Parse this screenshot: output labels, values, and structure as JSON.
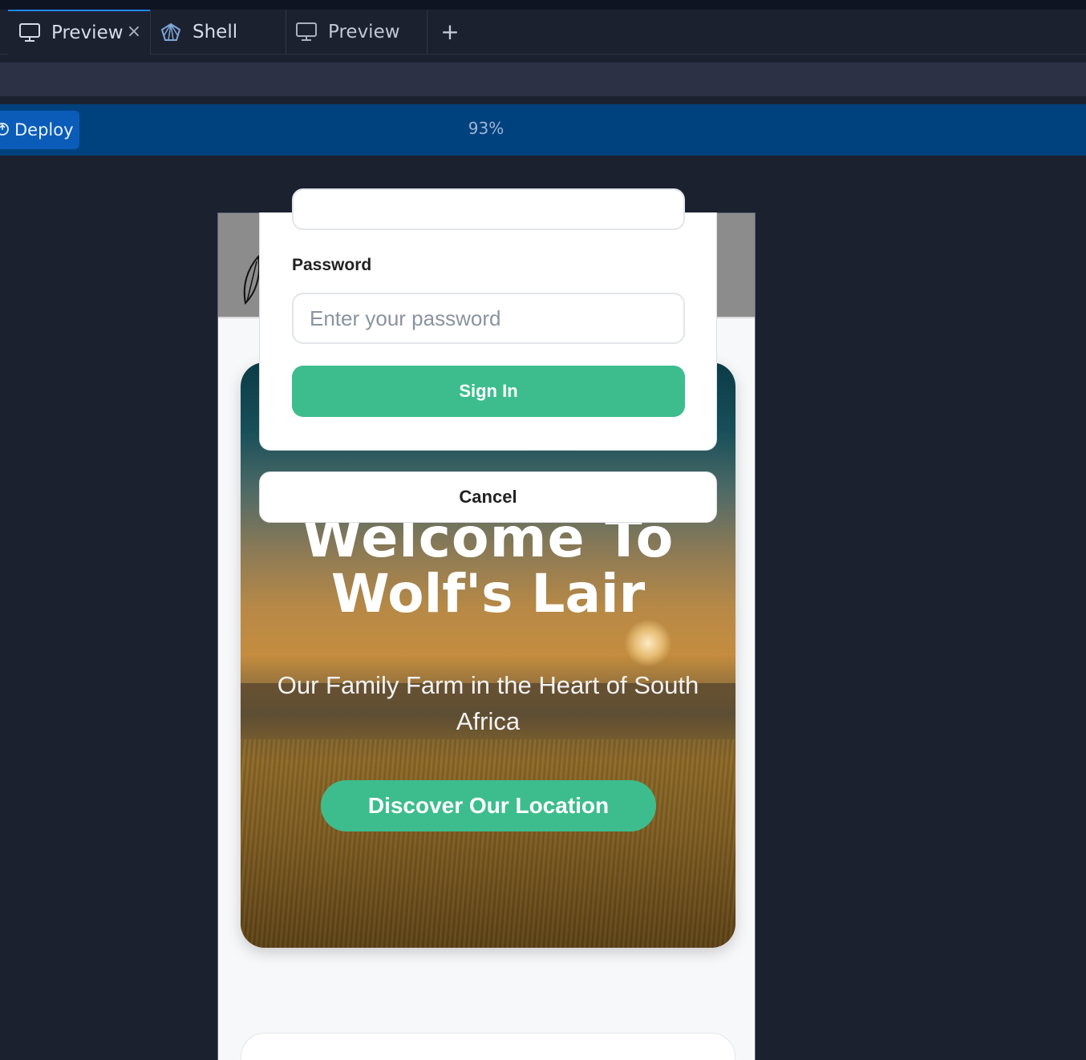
{
  "tabs": [
    {
      "label": "Preview",
      "icon": "monitor-icon",
      "active": true,
      "closable": true
    },
    {
      "label": "Shell",
      "icon": "shell-icon",
      "active": false
    },
    {
      "label": "Preview",
      "icon": "monitor-icon",
      "active": false
    }
  ],
  "toolbar": {
    "deploy_label": "Deploy",
    "zoom": "93%"
  },
  "modal": {
    "password_label": "Password",
    "password_placeholder": "Enter your password",
    "signin_label": "Sign In",
    "cancel_label": "Cancel"
  },
  "hero": {
    "title_line1": "Welcome To",
    "title_line2": "Wolf's Lair",
    "subtitle": "Our Family Farm in the Heart of South Africa",
    "cta_label": "Discover Our Location"
  },
  "colors": {
    "accent": "#3dbd8d",
    "deploy_bar": "#00427d",
    "deploy_button": "#0b5cb8",
    "tab_active_border": "#1f86ff"
  }
}
